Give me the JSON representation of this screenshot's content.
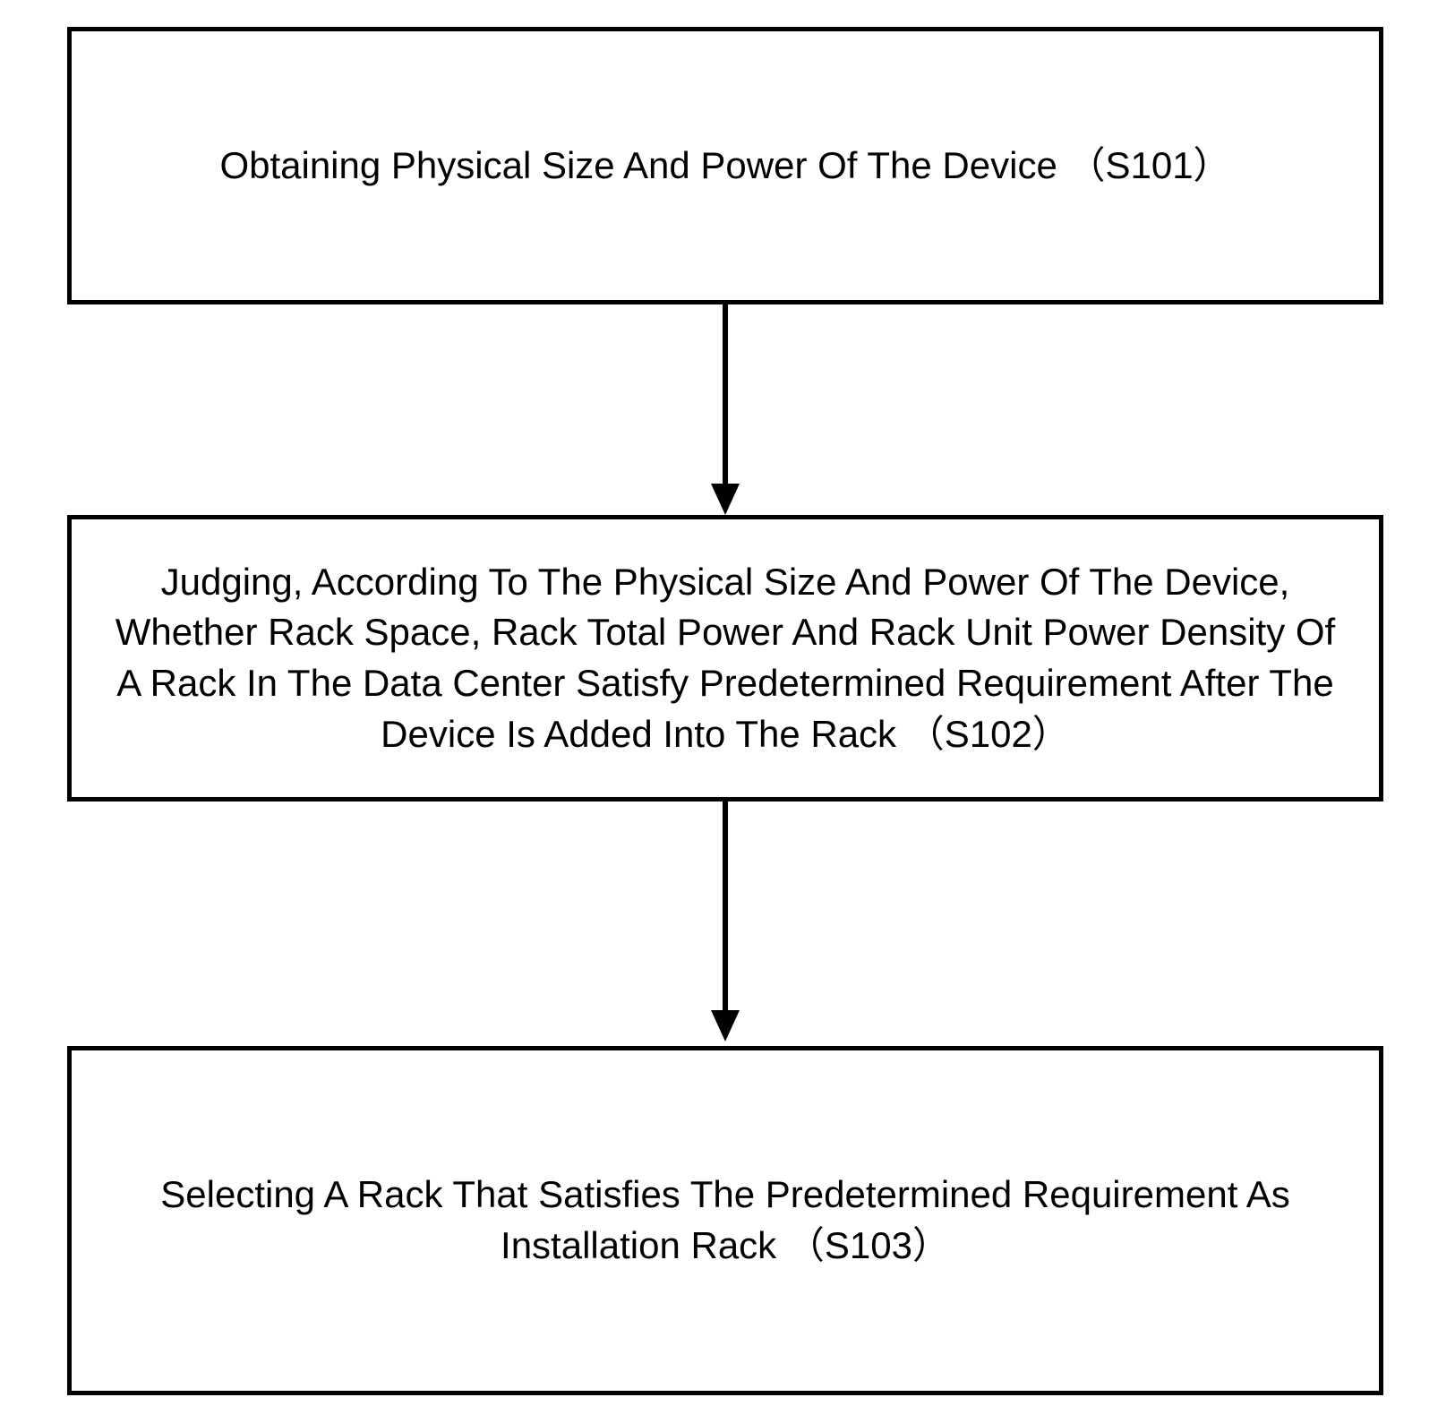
{
  "flowchart": {
    "steps": [
      {
        "id": "s101",
        "text": "Obtaining Physical Size And Power Of The Device （S101）"
      },
      {
        "id": "s102",
        "text": "Judging, According To The Physical Size And Power Of The Device, Whether Rack Space, Rack Total Power And Rack Unit Power Density Of A Rack In The Data Center Satisfy Predetermined Requirement After The Device Is Added Into The Rack （S102）"
      },
      {
        "id": "s103",
        "text": "Selecting A Rack That Satisfies The Predetermined Requirement As Installation Rack （S103）"
      }
    ]
  }
}
